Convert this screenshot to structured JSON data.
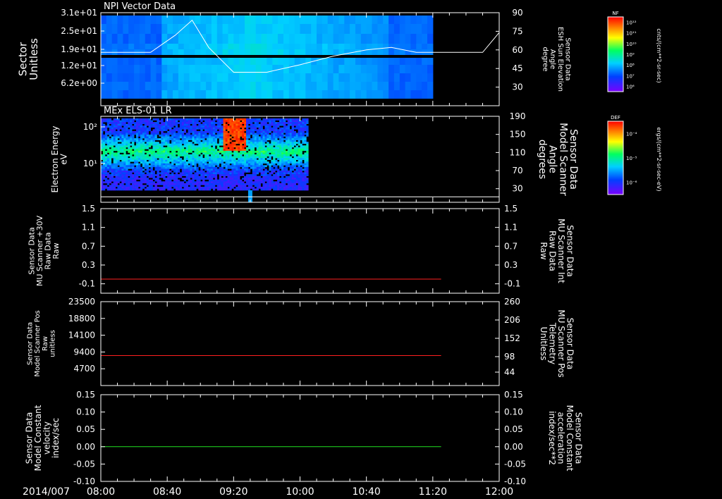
{
  "time_axis": {
    "date_label": "2014/007",
    "ticks": [
      "08:00",
      "08:40",
      "09:20",
      "10:00",
      "10:40",
      "11:20",
      "12:00"
    ]
  },
  "colors": {
    "white": "#ffffff",
    "red": "#ff2020",
    "green": "#20e020",
    "grid": "#ffffff"
  },
  "chart_data": [
    {
      "type": "heatmap",
      "title": "NPI Vector Data",
      "ylabel": "Sector\nUnitless",
      "y_ticks": [
        "3.1e+01",
        "2.5e+01",
        "1.9e+01",
        "1.2e+01",
        "6.2e+00"
      ],
      "right_ylabel": "Sensor Data\nESH Sun Elevation\nAngle\ndegree",
      "right_ticks": [
        "90",
        "75",
        "60",
        "45",
        "30"
      ],
      "right_ylim": [
        15,
        90
      ],
      "data_end": "11:20",
      "overlay_line": {
        "name": "ESH Sun Elevation Angle",
        "x": [
          "08:00",
          "08:30",
          "08:45",
          "08:55",
          "09:05",
          "09:20",
          "09:40",
          "10:00",
          "10:20",
          "10:40",
          "10:55",
          "11:10",
          "11:30",
          "11:50",
          "12:00"
        ],
        "y": [
          58,
          58,
          72,
          84,
          62,
          42,
          42,
          48,
          55,
          60,
          62,
          58,
          58,
          58,
          74
        ]
      },
      "colorbar": {
        "label": "NF",
        "unit": "cnts/(cm**2-sr-sec)",
        "ticks": [
          "10¹²",
          "10¹¹",
          "10¹⁰",
          "10⁹",
          "10⁸",
          "10⁷",
          "10⁶"
        ]
      }
    },
    {
      "type": "heatmap",
      "title": "MEx ELS-01 LR",
      "ylabel": "Electron Energy\neV",
      "y_ticks": [
        "10²",
        "10¹"
      ],
      "right_ylabel": "Sensor Data\nModel Scanner\nAngle\ndegrees",
      "right_ticks": [
        "190",
        "150",
        "110",
        "70",
        "30"
      ],
      "right_ylim": [
        0,
        190
      ],
      "data_end": "10:05",
      "overlay_line": {
        "name": "Model Scanner Angle",
        "value": 12
      },
      "colorbar": {
        "label": "DEF",
        "unit": "ergs/(cm**2-sr-sec-eV)",
        "ticks": [
          "10⁻⁴",
          "10⁻⁵",
          "10⁻⁶"
        ]
      }
    },
    {
      "type": "line",
      "ylabel": "Sensor Data\nMU Scanner +30V\nRaw Data\nRaw",
      "y_ticks": [
        "1.5",
        "1.1",
        "0.7",
        "0.3",
        "-0.1"
      ],
      "ylim": [
        -0.3,
        1.5
      ],
      "right_ylabel": "Sensor Data\nMU Scanner Int\nRaw Data\nRaw",
      "right_ticks": [
        "1.5",
        "1.1",
        "0.7",
        "0.3",
        "-0.1"
      ],
      "series": [
        {
          "name": "MU Scanner Int",
          "color": "#ff2020",
          "x": [
            "08:00",
            "11:25"
          ],
          "y": [
            0.0,
            0.0
          ]
        }
      ]
    },
    {
      "type": "line",
      "ylabel": "Sensor Data\nModel Scanner Pos\nRaw\nunitless",
      "y_ticks": [
        "23500",
        "18800",
        "14100",
        "9400",
        "4700"
      ],
      "ylim": [
        0,
        23500
      ],
      "right_ylabel": "Sensor Data\nMU Scanner Pos\nTelemetry\nUnitless",
      "right_ticks": [
        "260",
        "206",
        "152",
        "98",
        "44"
      ],
      "series": [
        {
          "name": "MU Scanner Pos",
          "color": "#ff2020",
          "x": [
            "08:00",
            "11:25"
          ],
          "y": [
            8400,
            8400
          ]
        }
      ]
    },
    {
      "type": "line",
      "ylabel": "Sensor Data\nModel Constant\nvelocity\nindex/sec",
      "y_ticks": [
        "0.15",
        "0.10",
        "0.05",
        "0.00",
        "-0.05",
        "-0.10"
      ],
      "ylim": [
        -0.1,
        0.15
      ],
      "right_ylabel": "Sensor Data\nModel Constant\nacceleration\nindex/sec**2",
      "right_ticks": [
        "0.15",
        "0.10",
        "0.05",
        "0.00",
        "-0.05",
        "-0.10"
      ],
      "series": [
        {
          "name": "Model Constant acceleration",
          "color": "#20e020",
          "x": [
            "08:00",
            "11:25"
          ],
          "y": [
            0.0,
            0.0
          ]
        }
      ]
    }
  ]
}
